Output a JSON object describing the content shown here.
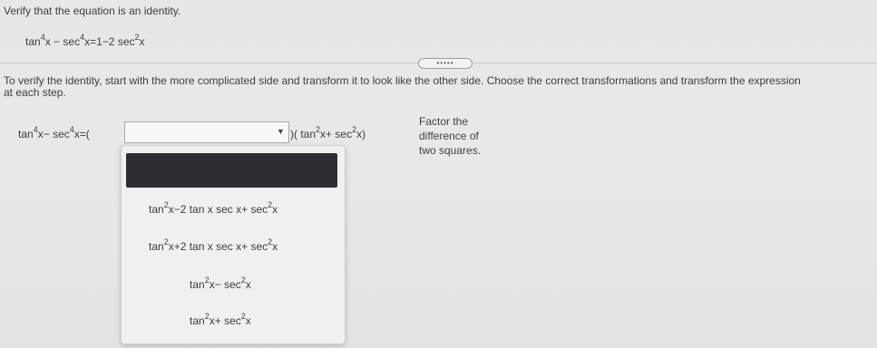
{
  "question": {
    "instruction": "Verify that the equation is an identity.",
    "equation": {
      "lhs_t1": "tan",
      "lhs_t1_exp": "4",
      "lhs_t1_var": "x",
      "minus": "−",
      "lhs_t2": "sec",
      "lhs_t2_exp": "4",
      "lhs_t2_var": "x",
      "equals_rhs": "=1−2",
      "rhs_t": "sec",
      "rhs_t_exp": "2",
      "rhs_t_var": "x"
    }
  },
  "more_button": {
    "label": "•••••"
  },
  "body_instruction_line1": "To verify the identity, start with the more complicated side and transform it to look like the other side. Choose the correct transformations and transform the expression",
  "body_instruction_line2": "at each step.",
  "step": {
    "lhs": {
      "t1": "tan",
      "e1": "4",
      "v1": "x−",
      "t2": "sec",
      "e2": "4",
      "v2": "x=("
    },
    "dropdown_value": "",
    "dropdown_arrow": "▼",
    "close_paren": ")",
    "right_factor": {
      "open": "(",
      "t1": "tan",
      "e1": "2",
      "v1": "x+",
      "t2": "sec",
      "e2": "2",
      "v2": "x)"
    }
  },
  "hint": {
    "line1": "Factor the",
    "line2": "difference of",
    "line3": "two squares."
  },
  "options": [
    {
      "a": "tan",
      "ae": "2",
      "mid": "x−2 tan x  sec x+",
      "b": "sec",
      "be": "2",
      "end": "x"
    },
    {
      "a": "tan",
      "ae": "2",
      "mid": "x+2 tan x  sec x+",
      "b": "sec",
      "be": "2",
      "end": "x"
    },
    {
      "a": "tan",
      "ae": "2",
      "mid": "x−",
      "b": "sec",
      "be": "2",
      "end": "x"
    },
    {
      "a": "tan",
      "ae": "2",
      "mid": "x+",
      "b": "sec",
      "be": "2",
      "end": "x"
    }
  ]
}
